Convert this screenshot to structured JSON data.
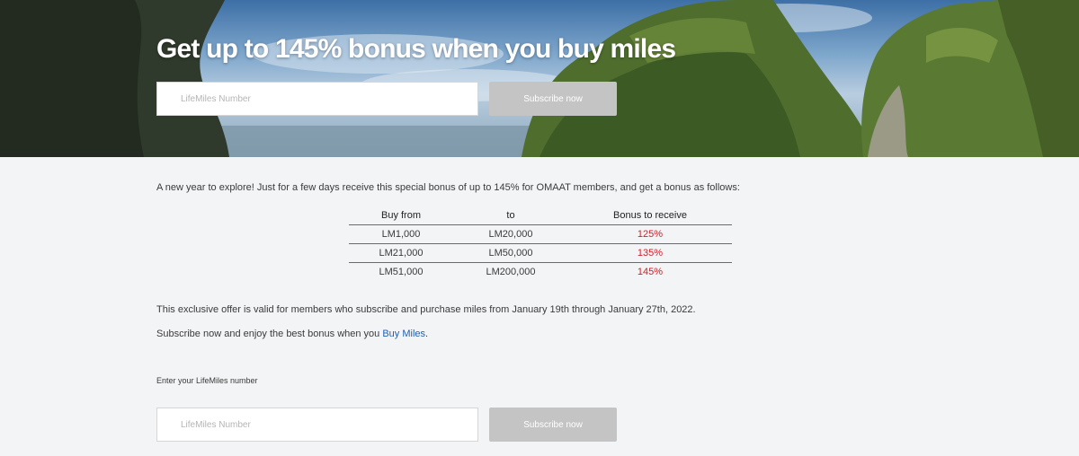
{
  "hero": {
    "title": "Get up to 145% bonus when you buy miles",
    "input_placeholder": "LifeMiles Number",
    "button_label": "Subscribe now"
  },
  "content": {
    "intro": "A new year to explore! Just for a few days receive this special bonus of up to 145% for OMAAT members, and get a bonus as follows:",
    "table": {
      "headers": [
        "Buy from",
        "to",
        "Bonus to receive"
      ],
      "rows": [
        [
          "LM1,000",
          "LM20,000",
          "125%"
        ],
        [
          "LM21,000",
          "LM50,000",
          "135%"
        ],
        [
          "LM51,000",
          "LM200,000",
          "145%"
        ]
      ]
    },
    "validity": "This exclusive offer is valid for members who subscribe and purchase miles from January 19th through January 27th, 2022.",
    "subscribe_text": "Subscribe now and enjoy the best bonus when you ",
    "buy_miles_link": "Buy Miles",
    "subscribe_text_end": "."
  },
  "form": {
    "label": "Enter your LifeMiles number",
    "input_placeholder": "LifeMiles Number",
    "button_label": "Subscribe now"
  },
  "colors": {
    "accent_red": "#d0202a",
    "link_blue": "#1f5fae",
    "button_gray": "#c4c4c4",
    "page_bg": "#f3f4f6"
  }
}
